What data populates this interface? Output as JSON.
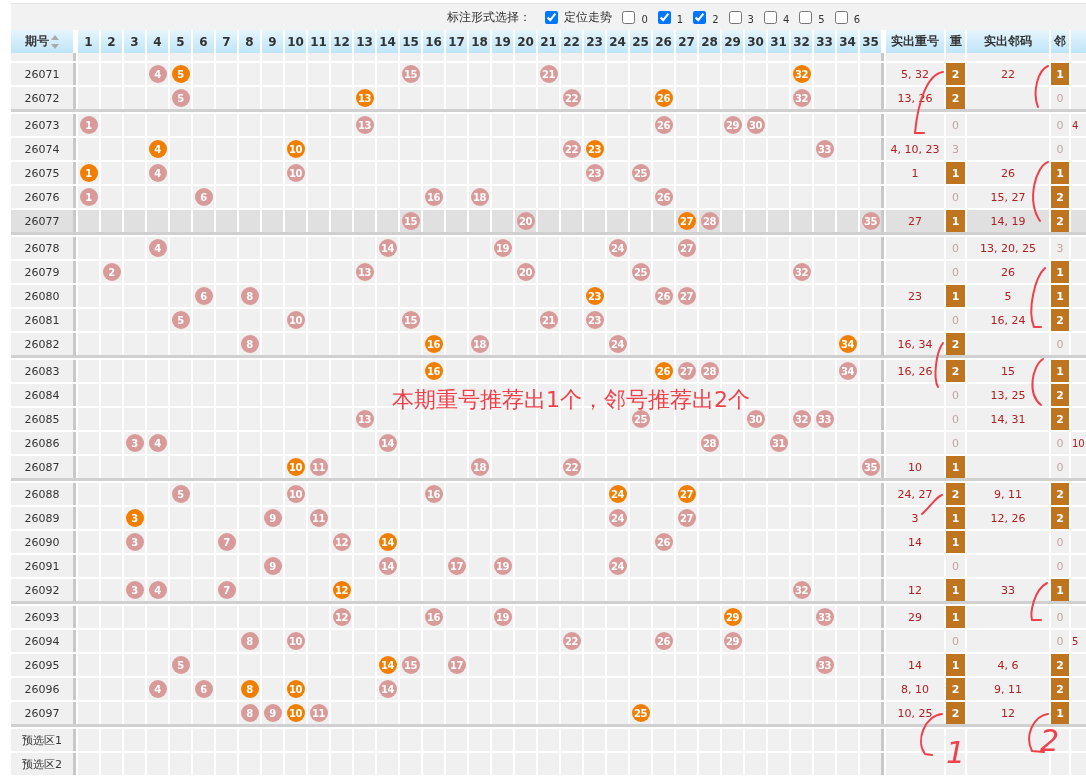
{
  "option_bar": {
    "label": "标注形式选择：",
    "options": [
      {
        "label": "定位走势",
        "checked": true
      },
      {
        "label": "0",
        "checked": false
      },
      {
        "label": "1",
        "checked": true
      },
      {
        "label": "2",
        "checked": true
      },
      {
        "label": "3",
        "checked": false
      },
      {
        "label": "4",
        "checked": false
      },
      {
        "label": "5",
        "checked": false
      },
      {
        "label": "6",
        "checked": false
      }
    ]
  },
  "table": {
    "period_header": "期号",
    "numbers": [
      "1",
      "2",
      "3",
      "4",
      "5",
      "6",
      "7",
      "8",
      "9",
      "10",
      "11",
      "12",
      "13",
      "14",
      "15",
      "16",
      "17",
      "18",
      "19",
      "20",
      "21",
      "22",
      "23",
      "24",
      "25",
      "26",
      "27",
      "28",
      "29",
      "30",
      "31",
      "32",
      "33",
      "34",
      "35"
    ],
    "repeat_header": "实出重号",
    "repeat_count_header": "重",
    "neighbor_header": "实出邻码",
    "neighbor_count_header": "邻",
    "rows": [
      {
        "period": "26071",
        "selected": false,
        "balls": [
          {
            "n": "4",
            "hot": false
          },
          {
            "n": "5",
            "hot": true
          },
          {
            "n": "15",
            "hot": false
          },
          {
            "n": "21",
            "hot": false
          },
          {
            "n": "32",
            "hot": true
          }
        ],
        "repeat": "5, 32",
        "repeat_count": "2",
        "repeat_marked": true,
        "neighbor": "22",
        "neighbor_count": "1",
        "neighbor_marked": true
      },
      {
        "period": "26072",
        "selected": false,
        "balls": [
          {
            "n": "5",
            "hot": false
          },
          {
            "n": "13",
            "hot": true
          },
          {
            "n": "22",
            "hot": false
          },
          {
            "n": "26",
            "hot": true
          },
          {
            "n": "32",
            "hot": false
          }
        ],
        "repeat": "13, 26",
        "repeat_count": "2",
        "repeat_marked": true,
        "neighbor_count": "0",
        "neighbor_marked": false
      },
      {
        "period": "26073",
        "selected": false,
        "balls": [
          {
            "n": "1",
            "hot": false
          },
          {
            "n": "13",
            "hot": false
          },
          {
            "n": "26",
            "hot": false
          },
          {
            "n": "29",
            "hot": false
          },
          {
            "n": "30",
            "hot": false
          }
        ],
        "repeat_count": "0",
        "repeat_marked": false,
        "neighbor_count": "0",
        "neighbor_marked": false,
        "extra": "4"
      },
      {
        "period": "26074",
        "selected": false,
        "balls": [
          {
            "n": "4",
            "hot": true
          },
          {
            "n": "10",
            "hot": true
          },
          {
            "n": "22",
            "hot": false
          },
          {
            "n": "23",
            "hot": true
          },
          {
            "n": "33",
            "hot": false
          }
        ],
        "repeat": "4, 10, 23",
        "repeat_count": "3",
        "repeat_marked": false,
        "neighbor_count": "0",
        "neighbor_marked": false
      },
      {
        "period": "26075",
        "selected": false,
        "balls": [
          {
            "n": "1",
            "hot": true
          },
          {
            "n": "4",
            "hot": false
          },
          {
            "n": "10",
            "hot": false
          },
          {
            "n": "23",
            "hot": false
          },
          {
            "n": "25",
            "hot": false
          }
        ],
        "repeat": "1",
        "repeat_count": "1",
        "repeat_marked": true,
        "neighbor": "26",
        "neighbor_count": "1",
        "neighbor_marked": true
      },
      {
        "period": "26076",
        "selected": false,
        "balls": [
          {
            "n": "1",
            "hot": false
          },
          {
            "n": "6",
            "hot": false
          },
          {
            "n": "16",
            "hot": false
          },
          {
            "n": "18",
            "hot": false
          },
          {
            "n": "26",
            "hot": false
          }
        ],
        "repeat_count": "0",
        "repeat_marked": false,
        "neighbor": "15, 27",
        "neighbor_count": "2",
        "neighbor_marked": true
      },
      {
        "period": "26077",
        "selected": true,
        "balls": [
          {
            "n": "15",
            "hot": false
          },
          {
            "n": "20",
            "hot": false
          },
          {
            "n": "27",
            "hot": true
          },
          {
            "n": "28",
            "hot": false
          },
          {
            "n": "35",
            "hot": false
          }
        ],
        "repeat": "27",
        "repeat_count": "1",
        "repeat_marked": true,
        "neighbor": "14, 19",
        "neighbor_count": "2",
        "neighbor_marked": true
      },
      {
        "period": "26078",
        "selected": false,
        "balls": [
          {
            "n": "4",
            "hot": false
          },
          {
            "n": "14",
            "hot": false
          },
          {
            "n": "19",
            "hot": false
          },
          {
            "n": "24",
            "hot": false
          },
          {
            "n": "27",
            "hot": false
          }
        ],
        "repeat_count": "0",
        "repeat_marked": false,
        "neighbor": "13, 20, 25",
        "neighbor_count": "3",
        "neighbor_marked": false
      },
      {
        "period": "26079",
        "selected": false,
        "balls": [
          {
            "n": "2",
            "hot": false
          },
          {
            "n": "13",
            "hot": false
          },
          {
            "n": "20",
            "hot": false
          },
          {
            "n": "25",
            "hot": false
          },
          {
            "n": "32",
            "hot": false
          }
        ],
        "repeat_count": "0",
        "repeat_marked": false,
        "neighbor": "26",
        "neighbor_count": "1",
        "neighbor_marked": true
      },
      {
        "period": "26080",
        "selected": false,
        "balls": [
          {
            "n": "6",
            "hot": false
          },
          {
            "n": "8",
            "hot": false
          },
          {
            "n": "23",
            "hot": true
          },
          {
            "n": "26",
            "hot": false
          },
          {
            "n": "27",
            "hot": false
          }
        ],
        "repeat": "23",
        "repeat_count": "1",
        "repeat_marked": true,
        "neighbor": "5",
        "neighbor_count": "1",
        "neighbor_marked": true
      },
      {
        "period": "26081",
        "selected": false,
        "balls": [
          {
            "n": "5",
            "hot": false
          },
          {
            "n": "10",
            "hot": false
          },
          {
            "n": "15",
            "hot": false
          },
          {
            "n": "21",
            "hot": false
          },
          {
            "n": "23",
            "hot": false
          }
        ],
        "repeat_count": "0",
        "repeat_marked": false,
        "neighbor": "16, 24",
        "neighbor_count": "2",
        "neighbor_marked": true
      },
      {
        "period": "26082",
        "selected": false,
        "balls": [
          {
            "n": "8",
            "hot": false
          },
          {
            "n": "16",
            "hot": true
          },
          {
            "n": "18",
            "hot": false
          },
          {
            "n": "24",
            "hot": false
          },
          {
            "n": "34",
            "hot": true
          }
        ],
        "repeat": "16, 34",
        "repeat_count": "2",
        "repeat_marked": true,
        "neighbor_count": "0",
        "neighbor_marked": false
      },
      {
        "period": "26083",
        "selected": false,
        "balls": [
          {
            "n": "16",
            "hot": true
          },
          {
            "n": "26",
            "hot": true
          },
          {
            "n": "27",
            "hot": false
          },
          {
            "n": "28",
            "hot": false
          },
          {
            "n": "34",
            "hot": false
          }
        ],
        "repeat": "16, 26",
        "repeat_count": "2",
        "repeat_marked": true,
        "neighbor": "15",
        "neighbor_count": "1",
        "neighbor_marked": true
      },
      {
        "period": "26084",
        "selected": false,
        "repeat_count": "0",
        "repeat_marked": false,
        "neighbor": "13, 25",
        "neighbor_count": "2",
        "neighbor_marked": true
      },
      {
        "period": "26085",
        "selected": false,
        "balls": [
          {
            "n": "13",
            "hot": false
          },
          {
            "n": "25",
            "hot": false
          },
          {
            "n": "30",
            "hot": false
          },
          {
            "n": "32",
            "hot": false
          },
          {
            "n": "33",
            "hot": false
          }
        ],
        "repeat_count": "0",
        "repeat_marked": false,
        "neighbor": "14, 31",
        "neighbor_count": "2",
        "neighbor_marked": true
      },
      {
        "period": "26086",
        "selected": false,
        "balls": [
          {
            "n": "3",
            "hot": false
          },
          {
            "n": "4",
            "hot": false
          },
          {
            "n": "14",
            "hot": false
          },
          {
            "n": "28",
            "hot": false
          },
          {
            "n": "31",
            "hot": false
          }
        ],
        "repeat_count": "0",
        "repeat_marked": false,
        "neighbor_count": "0",
        "neighbor_marked": false,
        "extra": "10"
      },
      {
        "period": "26087",
        "selected": false,
        "balls": [
          {
            "n": "10",
            "hot": true
          },
          {
            "n": "11",
            "hot": false
          },
          {
            "n": "18",
            "hot": false
          },
          {
            "n": "22",
            "hot": false
          },
          {
            "n": "35",
            "hot": false
          }
        ],
        "repeat": "10",
        "repeat_count": "1",
        "repeat_marked": true,
        "neighbor_count": "0",
        "neighbor_marked": false
      },
      {
        "period": "26088",
        "selected": false,
        "balls": [
          {
            "n": "5",
            "hot": false
          },
          {
            "n": "10",
            "hot": false
          },
          {
            "n": "16",
            "hot": false
          },
          {
            "n": "24",
            "hot": true
          },
          {
            "n": "27",
            "hot": true
          }
        ],
        "repeat": "24, 27",
        "repeat_count": "2",
        "repeat_marked": true,
        "neighbor": "9, 11",
        "neighbor_count": "2",
        "neighbor_marked": true
      },
      {
        "period": "26089",
        "selected": false,
        "balls": [
          {
            "n": "3",
            "hot": true
          },
          {
            "n": "9",
            "hot": false
          },
          {
            "n": "11",
            "hot": false
          },
          {
            "n": "24",
            "hot": false
          },
          {
            "n": "27",
            "hot": false
          }
        ],
        "repeat": "3",
        "repeat_count": "1",
        "repeat_marked": true,
        "neighbor": "12, 26",
        "neighbor_count": "2",
        "neighbor_marked": true
      },
      {
        "period": "26090",
        "selected": false,
        "balls": [
          {
            "n": "3",
            "hot": false
          },
          {
            "n": "7",
            "hot": false
          },
          {
            "n": "12",
            "hot": false
          },
          {
            "n": "14",
            "hot": true
          },
          {
            "n": "26",
            "hot": false
          }
        ],
        "repeat": "14",
        "repeat_count": "1",
        "repeat_marked": true,
        "neighbor_count": "0",
        "neighbor_marked": false
      },
      {
        "period": "26091",
        "selected": false,
        "balls": [
          {
            "n": "9",
            "hot": false
          },
          {
            "n": "14",
            "hot": false
          },
          {
            "n": "17",
            "hot": false
          },
          {
            "n": "19",
            "hot": false
          },
          {
            "n": "24",
            "hot": false
          }
        ],
        "repeat_count": "0",
        "repeat_marked": false,
        "neighbor_count": "0",
        "neighbor_marked": false
      },
      {
        "period": "26092",
        "selected": false,
        "balls": [
          {
            "n": "3",
            "hot": false
          },
          {
            "n": "4",
            "hot": false
          },
          {
            "n": "7",
            "hot": false
          },
          {
            "n": "12",
            "hot": true
          },
          {
            "n": "32",
            "hot": false
          }
        ],
        "repeat": "12",
        "repeat_count": "1",
        "repeat_marked": true,
        "neighbor": "33",
        "neighbor_count": "1",
        "neighbor_marked": true
      },
      {
        "period": "26093",
        "selected": false,
        "balls": [
          {
            "n": "12",
            "hot": false
          },
          {
            "n": "16",
            "hot": false
          },
          {
            "n": "19",
            "hot": false
          },
          {
            "n": "29",
            "hot": true
          },
          {
            "n": "33",
            "hot": false
          }
        ],
        "repeat": "29",
        "repeat_count": "1",
        "repeat_marked": true,
        "neighbor_count": "0",
        "neighbor_marked": false
      },
      {
        "period": "26094",
        "selected": false,
        "balls": [
          {
            "n": "8",
            "hot": false
          },
          {
            "n": "10",
            "hot": false
          },
          {
            "n": "22",
            "hot": false
          },
          {
            "n": "26",
            "hot": false
          },
          {
            "n": "29",
            "hot": false
          }
        ],
        "repeat_count": "0",
        "repeat_marked": false,
        "neighbor_count": "0",
        "neighbor_marked": false,
        "extra": "5"
      },
      {
        "period": "26095",
        "selected": false,
        "balls": [
          {
            "n": "5",
            "hot": false
          },
          {
            "n": "14",
            "hot": true
          },
          {
            "n": "15",
            "hot": false
          },
          {
            "n": "17",
            "hot": false
          },
          {
            "n": "33",
            "hot": false
          }
        ],
        "repeat": "14",
        "repeat_count": "1",
        "repeat_marked": true,
        "neighbor": "4, 6",
        "neighbor_count": "2",
        "neighbor_marked": true
      },
      {
        "period": "26096",
        "selected": false,
        "balls": [
          {
            "n": "4",
            "hot": false
          },
          {
            "n": "6",
            "hot": false
          },
          {
            "n": "8",
            "hot": true
          },
          {
            "n": "10",
            "hot": true
          },
          {
            "n": "14",
            "hot": false
          }
        ],
        "repeat": "8, 10",
        "repeat_count": "2",
        "repeat_marked": true,
        "neighbor": "9, 11",
        "neighbor_count": "2",
        "neighbor_marked": true
      },
      {
        "period": "26097",
        "selected": false,
        "balls": [
          {
            "n": "8",
            "hot": false
          },
          {
            "n": "9",
            "hot": false
          },
          {
            "n": "10",
            "hot": true
          },
          {
            "n": "11",
            "hot": false
          },
          {
            "n": "25",
            "hot": true
          }
        ],
        "repeat": "10, 25",
        "repeat_count": "2",
        "repeat_marked": true,
        "neighbor": "12",
        "neighbor_count": "1",
        "neighbor_marked": true
      }
    ],
    "preselect_rows": [
      "预选区1",
      "预选区2"
    ]
  },
  "annotation": {
    "text": "本期重号推荐出1个，邻号推荐出2个",
    "handwritten_labels": [
      "1",
      "2"
    ]
  }
}
